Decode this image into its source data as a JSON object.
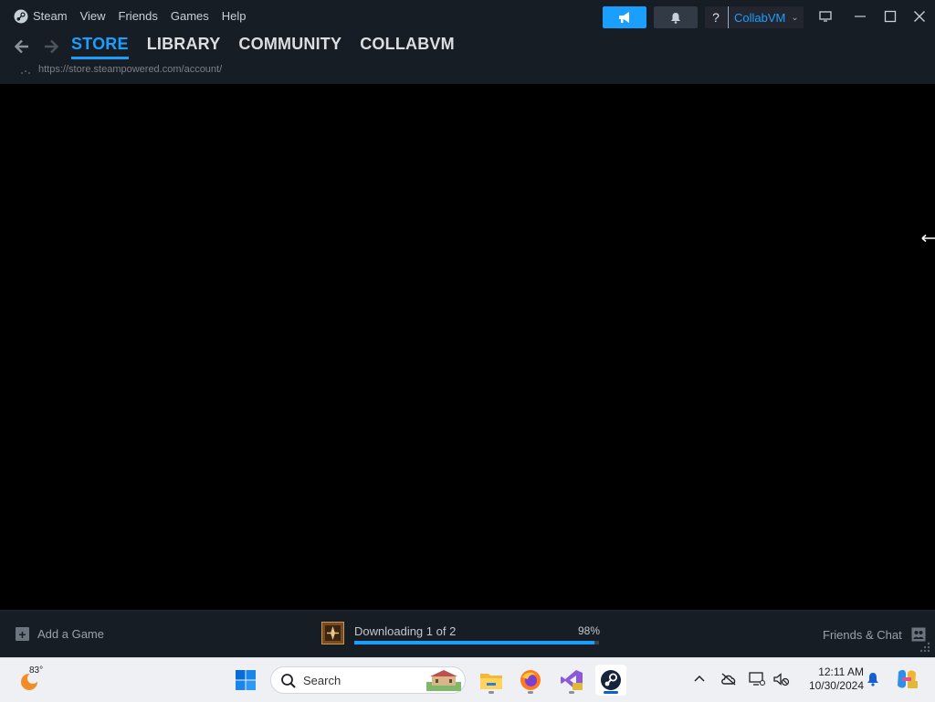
{
  "titlebar": {
    "menu": [
      "Steam",
      "View",
      "Friends",
      "Games",
      "Help"
    ],
    "help_label": "?",
    "account_name": "CollabVM",
    "icons": [
      "steam-logo",
      "megaphone-icon",
      "bell-icon",
      "monitor-icon",
      "minimize-icon",
      "maximize-icon",
      "close-icon"
    ]
  },
  "nav": {
    "tabs": [
      "STORE",
      "LIBRARY",
      "COMMUNITY",
      "COLLABVM"
    ],
    "active_tab": "STORE",
    "url": "https://store.steampowered.com/account/"
  },
  "bottombar": {
    "add_game": "Add a Game",
    "download_text": "Downloading 1 of 2",
    "download_percent": "98%",
    "download_progress": 0.98,
    "friends_chat": "Friends & Chat"
  },
  "taskbar": {
    "temperature": "83°",
    "search_placeholder": "Search",
    "time": "12:11 AM",
    "date": "10/30/2024"
  },
  "colors": {
    "accent": "#1a9fff",
    "window_bg": "#171d25",
    "content_bg": "#000000"
  }
}
